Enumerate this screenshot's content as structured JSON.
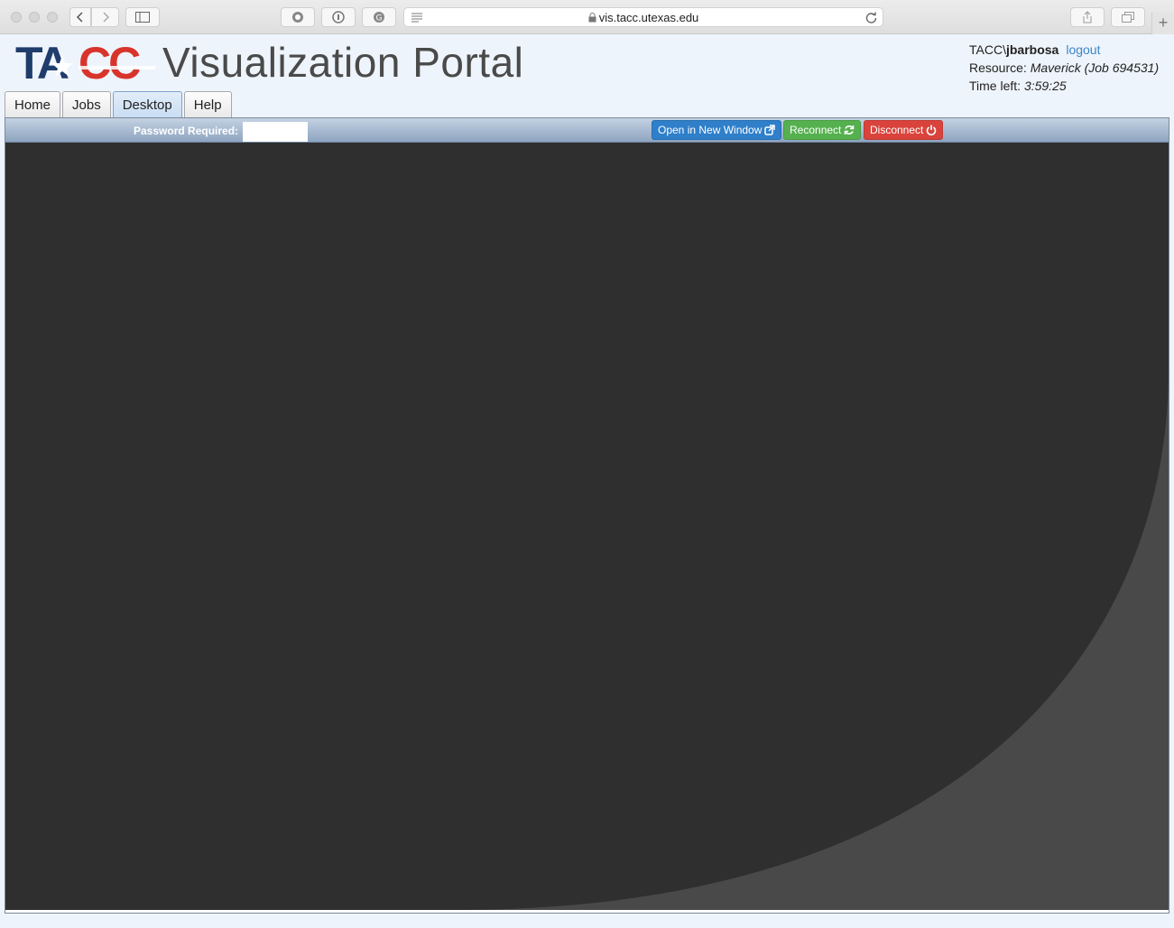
{
  "browser": {
    "url": "vis.tacc.utexas.edu",
    "new_tab_label": "+"
  },
  "header": {
    "logo_text": "TACC",
    "title": "Visualization Portal",
    "user_prefix": "TACC\\",
    "username": "jbarbosa",
    "logout_label": "logout",
    "resource_label": "Resource:",
    "resource_value": "Maverick (Job 694531)",
    "time_label": "Time left:",
    "time_value": "3:59:25"
  },
  "tabs": [
    {
      "label": "Home",
      "active": false
    },
    {
      "label": "Jobs",
      "active": false
    },
    {
      "label": "Desktop",
      "active": true
    },
    {
      "label": "Help",
      "active": false
    }
  ],
  "desktop": {
    "password_label": "Password Required:",
    "password_value": "",
    "open_new_window_label": "Open in New Window",
    "reconnect_label": "Reconnect",
    "disconnect_label": "Disconnect"
  },
  "colors": {
    "canvas_dark": "#2f2f2f",
    "canvas_light": "#494949",
    "tacc_blue": "#1f3d6b",
    "tacc_red": "#d8342c",
    "btn_blue": "#2f7fca",
    "btn_green": "#55b04e",
    "btn_red": "#d9433c"
  },
  "icons": [
    "lock-icon",
    "reload-icon",
    "external-link-icon",
    "refresh-icon",
    "power-icon"
  ]
}
